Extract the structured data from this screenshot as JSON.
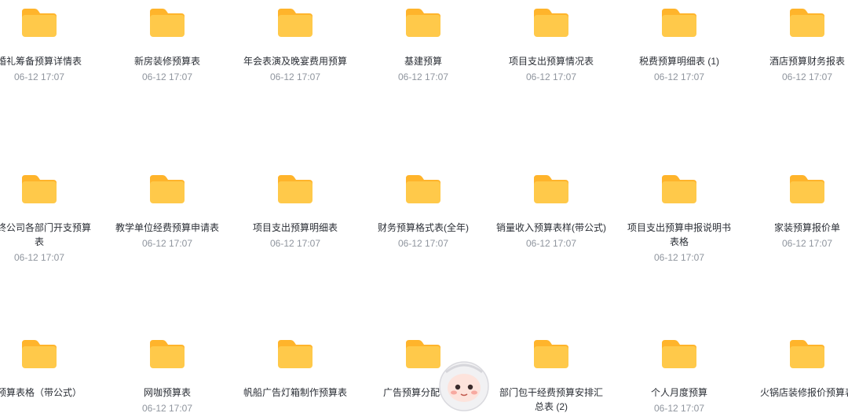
{
  "folder_color": "#FFC94A",
  "folder_tab_color": "#FFB42B",
  "items": [
    {
      "name": "婚礼筹备预算详情表",
      "time": "06-12 17:07"
    },
    {
      "name": "新房装修预算表",
      "time": "06-12 17:07"
    },
    {
      "name": "年会表演及晚宴费用预算",
      "time": "06-12 17:07"
    },
    {
      "name": "基建预算",
      "time": "06-12 17:07"
    },
    {
      "name": "项目支出预算情况表",
      "time": "06-12 17:07"
    },
    {
      "name": "税费预算明细表 (1)",
      "time": "06-12 17:07"
    },
    {
      "name": "酒店预算财务报表",
      "time": "06-12 17:07"
    },
    {
      "name": "年终公司各部门开支预算表",
      "time": "06-12 17:07"
    },
    {
      "name": "教学单位经费预算申请表",
      "time": "06-12 17:07"
    },
    {
      "name": "项目支出预算明细表",
      "time": "06-12 17:07"
    },
    {
      "name": "财务预算格式表(全年)",
      "time": "06-12 17:07"
    },
    {
      "name": "销量收入预算表样(带公式)",
      "time": "06-12 17:07"
    },
    {
      "name": "项目支出预算申报说明书表格",
      "time": "06-12 17:07"
    },
    {
      "name": "家装预算报价单",
      "time": "06-12 17:07"
    },
    {
      "name": "预算表格（带公式）",
      "time": ""
    },
    {
      "name": "网咖预算表",
      "time": "06-12 17:07"
    },
    {
      "name": "帆船广告灯箱制作预算表",
      "time": ""
    },
    {
      "name": "广告预算分配表 (2)",
      "time": ""
    },
    {
      "name": "部门包干经费预算安排汇总表 (2)",
      "time": ""
    },
    {
      "name": "个人月度预算",
      "time": "06-12 17:07"
    },
    {
      "name": "火锅店装修报价预算表",
      "time": ""
    }
  ]
}
